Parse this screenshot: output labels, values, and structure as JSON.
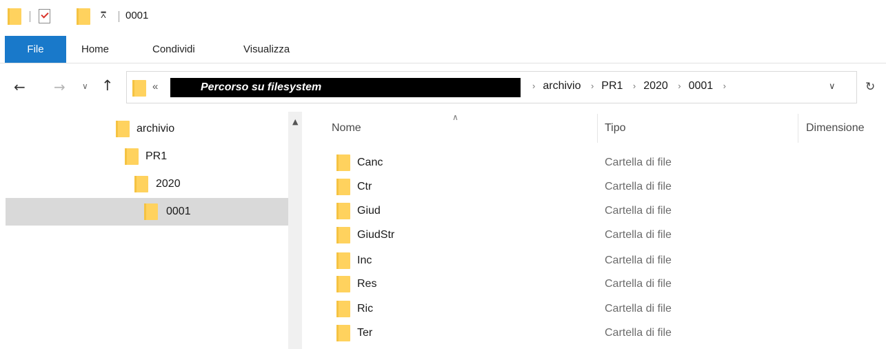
{
  "window": {
    "title": "0001"
  },
  "ribbon": {
    "tabs": [
      "File",
      "Home",
      "Condividi",
      "Visualizza"
    ]
  },
  "address": {
    "overflow": "«",
    "redacted_label": "Percorso su filesystem",
    "crumbs": [
      "archivio",
      "PR1",
      "2020",
      "0001"
    ]
  },
  "tree": [
    {
      "label": "archivio",
      "selected": false
    },
    {
      "label": "PR1",
      "selected": false
    },
    {
      "label": "2020",
      "selected": false
    },
    {
      "label": "0001",
      "selected": true
    }
  ],
  "columns": {
    "name": "Nome",
    "type": "Tipo",
    "size": "Dimensione"
  },
  "files": [
    {
      "name": "Canc",
      "type": "Cartella di file"
    },
    {
      "name": "Ctr",
      "type": "Cartella di file"
    },
    {
      "name": "Giud",
      "type": "Cartella di file"
    },
    {
      "name": "GiudStr",
      "type": "Cartella di file"
    },
    {
      "name": "Inc",
      "type": "Cartella di file"
    },
    {
      "name": "Res",
      "type": "Cartella di file"
    },
    {
      "name": "Ric",
      "type": "Cartella di file"
    },
    {
      "name": "Ter",
      "type": "Cartella di file"
    }
  ],
  "colors": {
    "accent": "#1979ca",
    "folder": "#ffd25e",
    "selection": "#d9d9d9"
  },
  "icons": {
    "back": "arrow-left-icon",
    "forward": "arrow-right-icon",
    "up": "arrow-up-icon",
    "refresh": "refresh-icon",
    "folder": "folder-icon"
  }
}
